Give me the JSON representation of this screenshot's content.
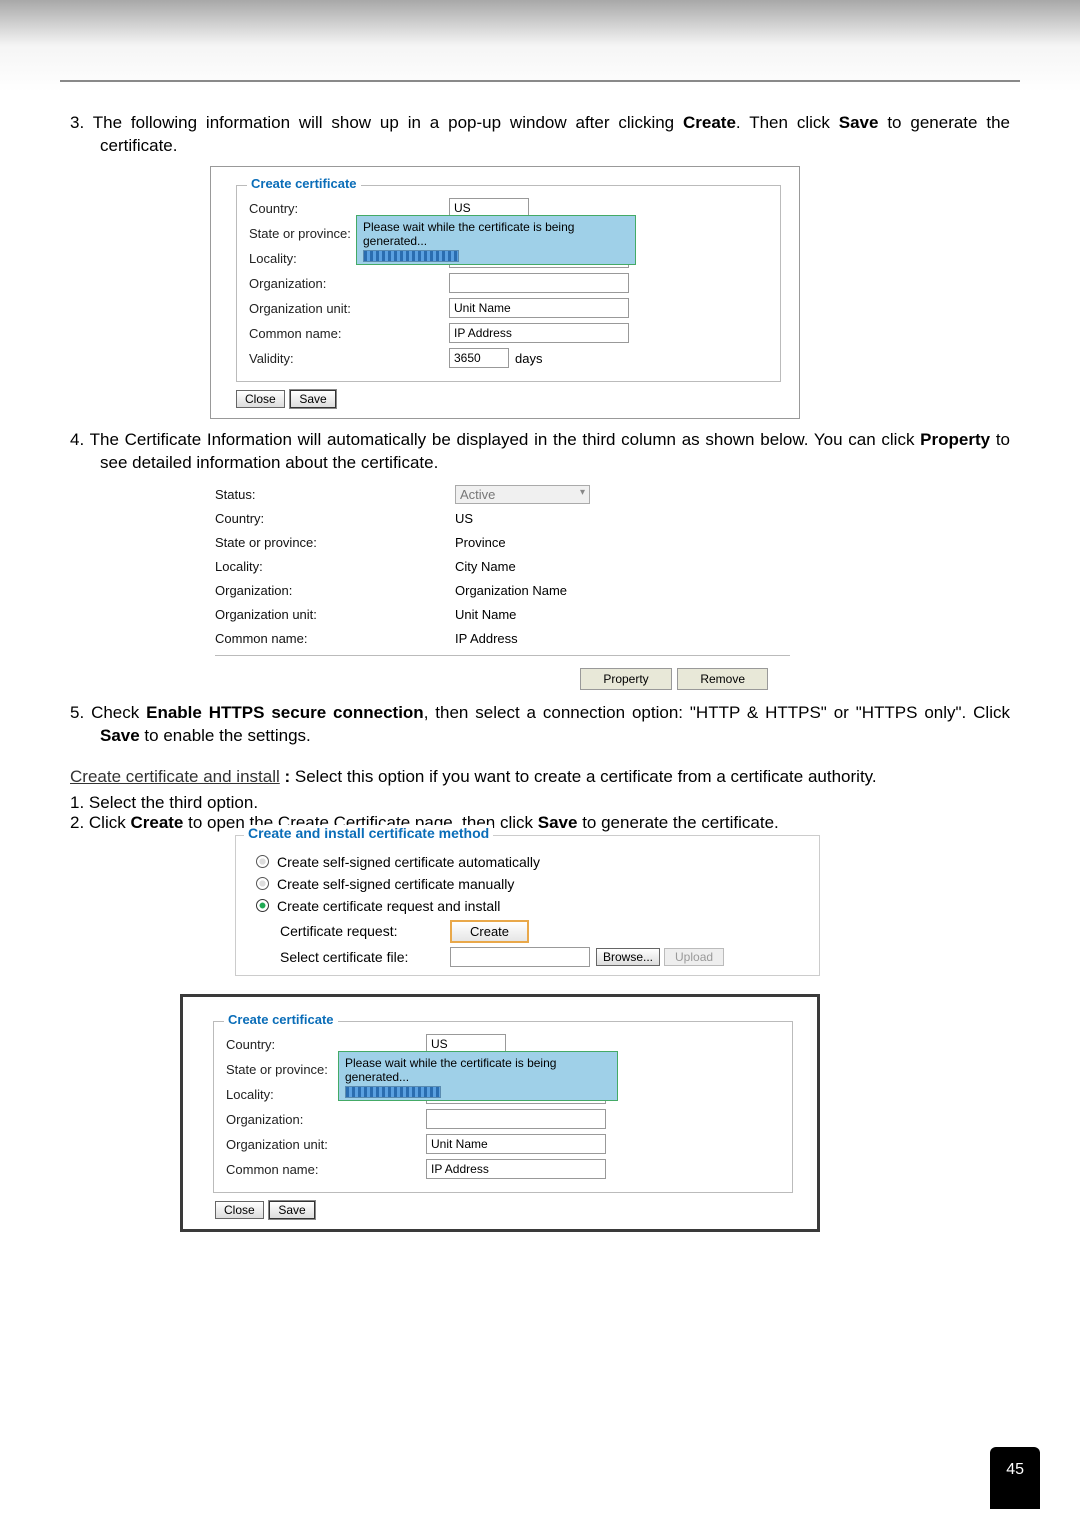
{
  "step3": {
    "num": "3.",
    "text": "The following information will show up in a pop-up window after clicking ",
    "bold1": "Create",
    "mid": ". Then click ",
    "bold2": "Save",
    "end": " to generate the certificate."
  },
  "createCert": {
    "legend": "Create certificate",
    "country_label": "Country:",
    "country_val": "US",
    "state_label": "State or province:",
    "locality_label": "Locality:",
    "org_label": "Organization:",
    "orgunit_label": "Organization unit:",
    "orgunit_val": "Unit Name",
    "common_label": "Common name:",
    "common_val": "IP Address",
    "validity_label": "Validity:",
    "validity_val": "3650",
    "validity_unit": "days",
    "close": "Close",
    "save": "Save"
  },
  "popup": "Please wait while the certificate is being generated...",
  "step4": {
    "num": "4.",
    "text": "The Certificate Information will automatically be displayed in the third column as shown below. You can click ",
    "bold": "Property",
    "end": " to see detailed information about the certificate."
  },
  "info": {
    "status_label": "Status:",
    "status_val": "Active",
    "country_label": "Country:",
    "country_val": "US",
    "state_label": "State or province:",
    "state_val": "Province",
    "locality_label": "Locality:",
    "locality_val": "City Name",
    "org_label": "Organization:",
    "org_val": "Organization Name",
    "orgunit_label": "Organization unit:",
    "orgunit_val": "Unit Name",
    "common_label": "Common name:",
    "common_val": "IP Address",
    "property": "Property",
    "remove": "Remove"
  },
  "step5": {
    "num": "5.",
    "a": "Check ",
    "b1": "Enable HTTPS secure connection",
    "b": ", then select a connection option: \"HTTP & HTTPS\" or \"HTTPS only\". Click ",
    "b2": "Save",
    "c": " to enable the settings."
  },
  "section": {
    "head": "Create certificate and install",
    "sep": " : ",
    "desc": "Select this option if you want to create a certificate from a certificate authority."
  },
  "sub1": "1. Select the third option.",
  "sub2a": "2. Click ",
  "sub2b": "Create",
  "sub2c": " to open the Create Certificate page, then click ",
  "sub2d": "Save",
  "sub2e": " to generate the certificate.",
  "method": {
    "legend": "Create and install certificate method",
    "r1": "Create self-signed certificate automatically",
    "r2": "Create self-signed certificate manually",
    "r3": "Create certificate request and install",
    "certreq_label": "Certificate request:",
    "create": "Create",
    "selectfile_label": "Select certificate file:",
    "browse": "Browse...",
    "upload": "Upload"
  },
  "page": "45"
}
